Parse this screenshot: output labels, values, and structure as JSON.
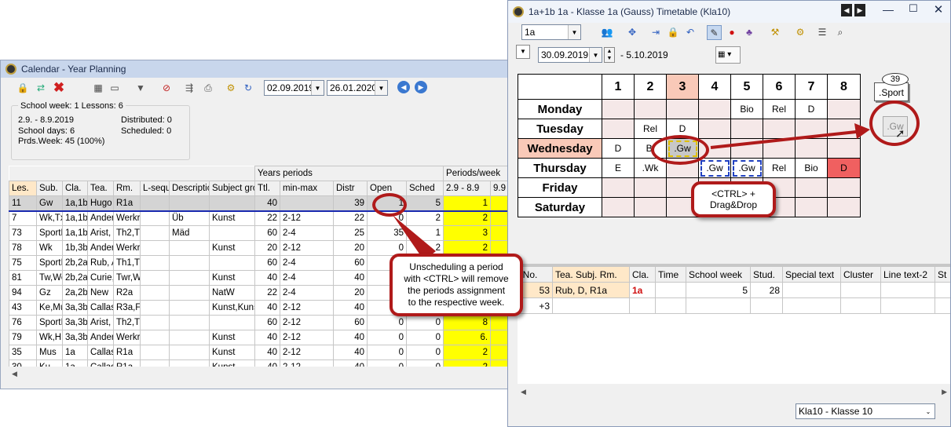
{
  "yp": {
    "title": "Calendar - Year Planning",
    "date_from": "02.09.2019",
    "date_to": "26.01.2020",
    "info": {
      "heading": "School week: 1  Lessons: 6",
      "range": "2.9. - 8.9.2019",
      "school_days": "School days: 6",
      "prds_week": "Prds.Week: 45 (100%)",
      "distributed": "Distributed: 0",
      "scheduled": "Scheduled: 0"
    },
    "group_years": "Years periods",
    "group_pw": "Periods/week",
    "columns": [
      "Les.",
      "Sub.",
      "Cla.",
      "Tea.",
      "Rm.",
      "L-sequ",
      "Descriptic",
      "Subject gro",
      "Ttl.",
      "min-max",
      "Distr",
      "Open",
      "Sched",
      "2.9 - 8.9",
      "9.9 -"
    ],
    "rows": [
      [
        "11",
        "Gw",
        "1a,1b,",
        "Hugo",
        "R1a",
        "",
        "",
        "",
        "40",
        "",
        "39",
        "1",
        "5",
        "1",
        ""
      ],
      [
        "7",
        "Wk,Tx",
        "1a,1b",
        "Ander",
        "Werkr",
        "",
        "Üb",
        "Kunst",
        "22",
        "2-12",
        "22",
        "0",
        "2",
        "2",
        ""
      ],
      [
        "73",
        "SportN",
        "1a,1b",
        "Arist, F",
        "Th2,T",
        "",
        "Mäd",
        "",
        "60",
        "2-4",
        "25",
        "35",
        "1",
        "3",
        ""
      ],
      [
        "78",
        "Wk",
        "1b,3b",
        "Ander",
        "Werkr",
        "",
        "",
        "Kunst",
        "20",
        "2-12",
        "20",
        "0",
        "2",
        "2",
        ""
      ],
      [
        "75",
        "SportI",
        "2b,2a",
        "Rub, A",
        "Th1,T",
        "",
        "",
        "",
        "60",
        "2-4",
        "60",
        "",
        "",
        "",
        ""
      ],
      [
        "81",
        "Tw,We",
        "2b,2a",
        "Curie,",
        "Twr,W",
        "",
        "",
        "Kunst",
        "40",
        "2-4",
        "40",
        "",
        "",
        "",
        ""
      ],
      [
        "94",
        "Gz",
        "2a,2b",
        "New",
        "R2a",
        "",
        "",
        "NatW",
        "22",
        "2-4",
        "20",
        "",
        "",
        "",
        ""
      ],
      [
        "43",
        "Ke,Mu",
        "3a,3b",
        "Callas",
        "R3a,F",
        "",
        "",
        "Kunst,Kuns",
        "40",
        "2-12",
        "40",
        "",
        "",
        "",
        ""
      ],
      [
        "76",
        "SportI",
        "3a,3b",
        "Arist, F",
        "Th2,T",
        "",
        "",
        "",
        "60",
        "2-12",
        "60",
        "0",
        "0",
        "8",
        ""
      ],
      [
        "79",
        "Wk,H",
        "3a,3b",
        "Ander",
        "Werkr",
        "",
        "",
        "Kunst",
        "40",
        "2-12",
        "40",
        "0",
        "0",
        "6.",
        ""
      ],
      [
        "35",
        "Mus",
        "1a",
        "Callas",
        "R1a",
        "",
        "",
        "Kunst",
        "40",
        "2-12",
        "40",
        "0",
        "0",
        "2",
        ""
      ],
      [
        "30",
        "Ku",
        "1a",
        "Callas",
        "R1a",
        "",
        "",
        "Kunst",
        "40",
        "2-12",
        "40",
        "0",
        "0",
        "2",
        ""
      ]
    ]
  },
  "tt": {
    "title": "1a+1b 1a - Klasse 1a (Gauss)  Timetable  (Kla10)",
    "class_select": "1a",
    "date": "30.09.2019",
    "date_end": "- 5.10.2019",
    "periods": [
      "1",
      "2",
      "3",
      "4",
      "5",
      "6",
      "7",
      "8"
    ],
    "days": [
      {
        "name": "Monday",
        "cells": [
          "",
          "",
          "",
          "",
          "Bio",
          "Rel",
          "D",
          ""
        ]
      },
      {
        "name": "Tuesday",
        "cells": [
          "",
          "Rel",
          "D",
          "",
          "",
          "",
          "",
          ""
        ]
      },
      {
        "name": "Wednesday",
        "cells": [
          "D",
          "Bi",
          ".Gw",
          "",
          "",
          "",
          "",
          ""
        ]
      },
      {
        "name": "Thursday",
        "cells": [
          "E",
          ".Wk",
          "",
          ".Gw",
          ".Gw",
          "Rel",
          "Bio",
          "D"
        ]
      },
      {
        "name": "Friday",
        "cells": [
          "",
          "",
          "",
          "",
          "",
          "",
          "",
          ""
        ]
      },
      {
        "name": "Saturday",
        "cells": [
          "",
          "",
          "",
          "",
          "",
          "",
          "",
          ""
        ]
      }
    ],
    "pin_count": "39",
    "pin_label": ".Sport",
    "drag_item": ".Gw",
    "callout_drag": "<CTRL> +\nDrag&Drop",
    "lesson_columns": [
      "L-No.",
      "Tea. Subj. Rm.",
      "Cla.",
      "Time",
      "School week",
      "Stud.",
      "Special text",
      "Cluster",
      "Line text-2",
      "St"
    ],
    "lesson_rows": [
      [
        "53",
        "Rub, D, R1a",
        "1a",
        "",
        "5",
        "28",
        "",
        "",
        "",
        ""
      ],
      [
        "+3",
        "",
        "",
        "",
        "",
        "",
        "",
        "",
        "",
        ""
      ]
    ],
    "footer_select": "Kla10 - Klasse 10"
  },
  "callout_unsched": "Unscheduling a period\nwith <CTRL> will remove\nthe periods assignment\nto the respective week.",
  "colors": {
    "accent_red": "#b01a1a",
    "yellow": "#ffff00",
    "pink": "#f9c9b8",
    "red_cell": "#f06060",
    "blue_line": "#1a2ab0"
  }
}
